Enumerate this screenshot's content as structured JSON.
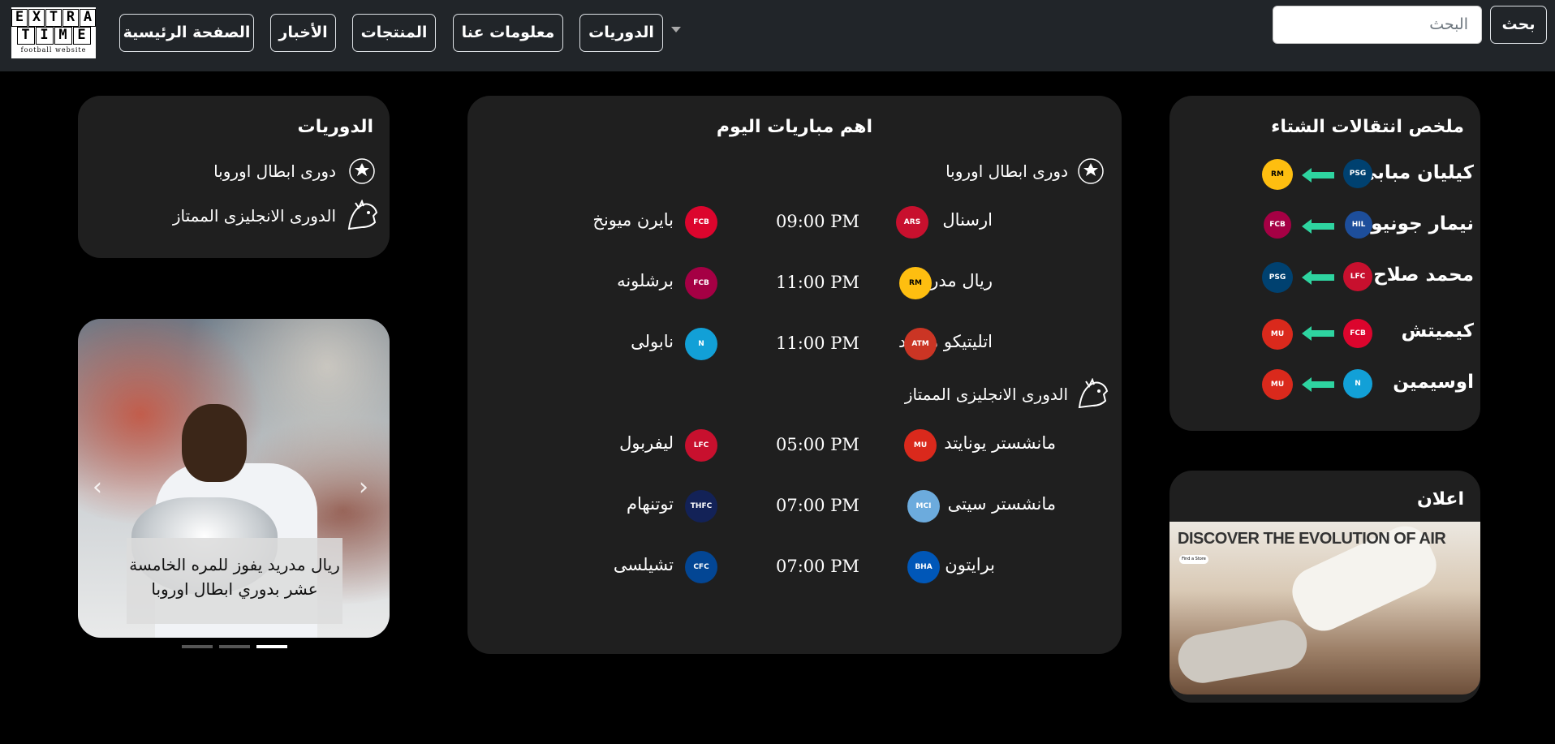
{
  "nav": {
    "logo": {
      "row1": [
        "E",
        "X",
        "T",
        "R",
        "A"
      ],
      "row2": [
        "T",
        "I",
        "M",
        "E"
      ],
      "sub": "football website"
    },
    "items": [
      "الصفحة الرئيسية",
      "الأخبار",
      "المنتجات",
      "معلومات عنا",
      "الدوريات"
    ],
    "search_placeholder": "البحث",
    "search_button": "بحث"
  },
  "leagues_card": {
    "title": "الدوريات",
    "items": [
      {
        "label": "دورى ابطال اوروبا",
        "icon": "champions-league-icon"
      },
      {
        "label": "الدورى الانجليزى الممتاز",
        "icon": "premier-league-icon"
      }
    ]
  },
  "carousel": {
    "caption": "ريال مدريد يفوز للمره الخامسة عشر بدوري ابطال اوروبا",
    "prev_symbol": "‹",
    "next_symbol": "›",
    "indicator_count": 3,
    "active_index": 2
  },
  "matches_card": {
    "title": "اهم مباريات اليوم",
    "groups": [
      {
        "league": "دورى ابطال اوروبا",
        "matches": [
          {
            "home": "ارسنال",
            "time": "09:00 PM",
            "away": "بايرن ميونخ",
            "home_color": "#c8102e",
            "away_color": "#dc052d"
          },
          {
            "home": "ريال مدريد",
            "time": "11:00 PM",
            "away": "برشلونه",
            "home_color": "#febe10",
            "away_color": "#a50044"
          },
          {
            "home": "اتليتيكو مدريد",
            "time": "11:00 PM",
            "away": "نابولى",
            "home_color": "#cb3524",
            "away_color": "#12a0d7"
          }
        ]
      },
      {
        "league": "الدورى الانجليزى الممتاز",
        "matches": [
          {
            "home": "مانشستر يونايتد",
            "time": "05:00 PM",
            "away": "ليفربول",
            "home_color": "#da291c",
            "away_color": "#c8102e"
          },
          {
            "home": "مانشستر سيتى",
            "time": "07:00 PM",
            "away": "توتنهام",
            "home_color": "#6cabdd",
            "away_color": "#132257"
          },
          {
            "home": "برايتون",
            "time": "07:00 PM",
            "away": "تشيلسى",
            "home_color": "#0057b8",
            "away_color": "#034694"
          }
        ]
      }
    ]
  },
  "transfers_card": {
    "title": "ملخص انتقالات الشتاء",
    "arrow_color": "#2ed4a0",
    "items": [
      {
        "player": "كيليان مبابى",
        "from_color": "#004170",
        "to_color": "#febe10"
      },
      {
        "player": "نيمار جونيور",
        "from_color": "#1d4e9b",
        "to_color": "#a50044"
      },
      {
        "player": "محمد صلاح",
        "from_color": "#c8102e",
        "to_color": "#004170"
      },
      {
        "player": "كيميتش",
        "from_color": "#dc052d",
        "to_color": "#da291c"
      },
      {
        "player": "اوسيمين",
        "from_color": "#12a0d7",
        "to_color": "#da291c"
      }
    ]
  },
  "ad_card": {
    "title": "اعلان",
    "headline": "DISCOVER THE EVOLUTION OF AIR",
    "button": "Find a Store"
  }
}
